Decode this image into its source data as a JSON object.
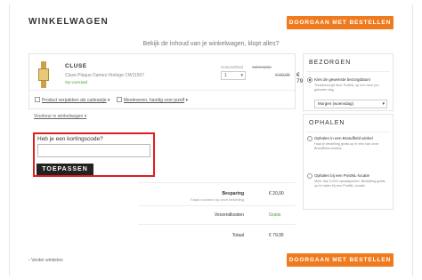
{
  "header": {
    "title": "WINKELWAGEN",
    "cta_label": "DOORGAAN MET BESTELLEN"
  },
  "intro": "Bekijk de inhoud van je winkelwagen, klopt alles?",
  "product": {
    "brand": "CLUSE",
    "name": "Cluse Plaque Dames Horloge CW11507",
    "stock": "Op voorraad",
    "qty_label": "Hoeveelheid",
    "qty_value": "1",
    "old_price_label": "Adviesprijs",
    "old_price": "€ 99,95",
    "price": "€ 79,95",
    "option_gift": "Product verpakken als cadeautje",
    "option_warranty": "Meeleveren, handig voor jezelf"
  },
  "more_link": "Voorkeur in winkelwagen",
  "coupon": {
    "label": "Heb je een kortingscode?",
    "input_value": "",
    "button": "TOEPASSEN"
  },
  "summary": {
    "savings_label": "Besparing",
    "savings_value": "€ 20,00",
    "savings_note": "Totaal voordeel op deze bestelling",
    "shipping_label": "Verzendkosten",
    "shipping_value": "Gratis",
    "total_label": "Totaal",
    "total_value": "€ 79,95"
  },
  "delivery": {
    "title": "BEZORGEN",
    "option_title": "Kies de gewenste bezorgdatum",
    "option_desc": "Thuisbezorgd door PostNL op een door jou gekozen dag",
    "select_value": "Morgen (woensdag)"
  },
  "pickup": {
    "title": "OPHALEN",
    "option1_title": "Ophalen in een Brandfield winkel",
    "option1_desc": "Haal je bestelling gratis op in één van onze Brandfield winkels",
    "option2_title": "Ophalen bij een PostNL-locatie",
    "option2_desc": "Meer dan 3.000 ophaalpunten. Bestelling gratis op te halen bij een PostNL-locatie"
  },
  "back_link": "Verder winkelen",
  "colors": {
    "accent": "#f07b1f",
    "highlight": "#e11d1d",
    "dark_button": "#222222",
    "in_stock": "#4a9a3a"
  }
}
